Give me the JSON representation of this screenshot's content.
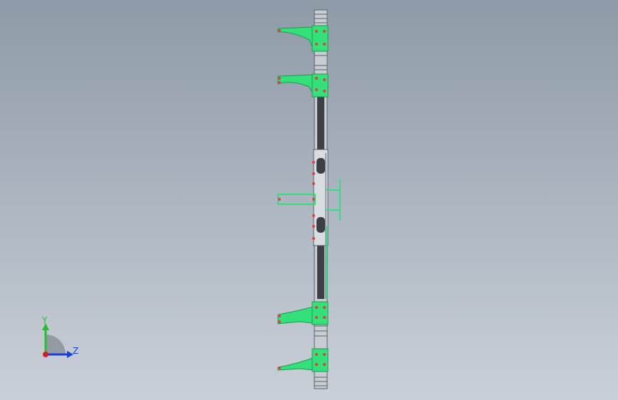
{
  "viewport": {
    "background_top": "#8f9aa8",
    "background_bottom": "#c9d0d8"
  },
  "model": {
    "part_color": "#33e07a",
    "part_edge_color": "#1f9a4e",
    "frame_color": "#d9dde2",
    "frame_edge_color": "#5c6168",
    "rod_color": "#3c3f44",
    "hole_color": "#e0403a"
  },
  "triad": {
    "y_label": "Y",
    "z_label": "Z",
    "y_color": "#22c22a",
    "z_color": "#1a3fd6",
    "x_color": "#d81e1e"
  }
}
